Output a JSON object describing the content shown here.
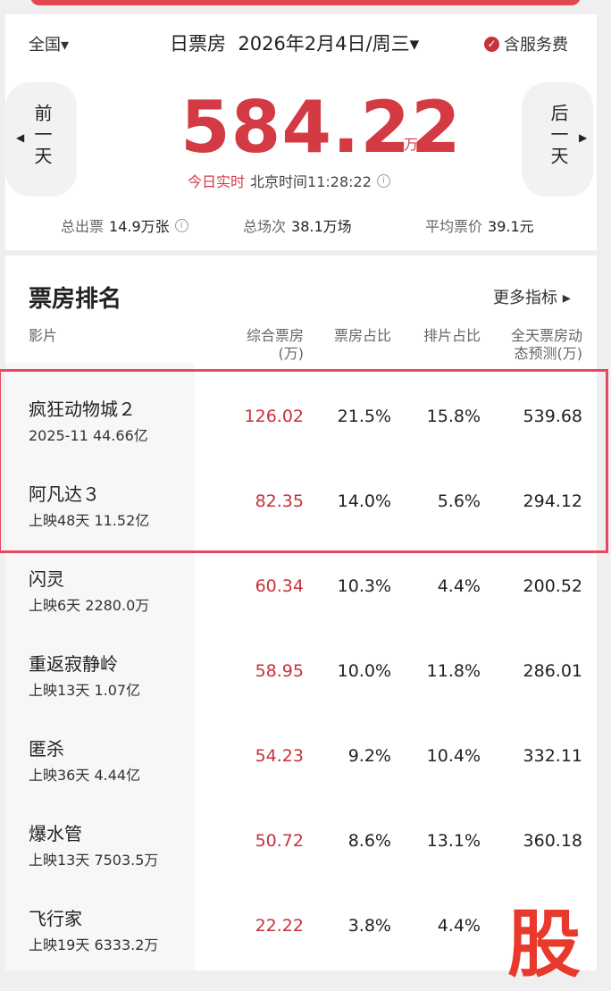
{
  "header": {
    "region": "全国",
    "region_arrow": "▾",
    "title": "日票房",
    "date": "2026年2月4日/周三",
    "date_arrow": "▾",
    "service_label": "含服务费",
    "check_icon": "✓"
  },
  "nav": {
    "prev_label": "前一天",
    "prev_arrow": "◀",
    "next_label": "后一天",
    "next_arrow": "▶"
  },
  "total": {
    "value": "584.22",
    "unit": "万",
    "live_label": "今日实时",
    "clock": "北京时间11:28:22",
    "info_icon": "i"
  },
  "stats": {
    "tickets_label": "总出票",
    "tickets_value": "14.9万张",
    "screenings_label": "总场次",
    "screenings_value": "38.1万场",
    "avg_price_label": "平均票价",
    "avg_price_value": "39.1元"
  },
  "ranking": {
    "title": "票房排名",
    "more_label": "更多指标",
    "more_arrow": "▸",
    "columns": {
      "movie": "影片",
      "box_office_l1": "综合票房",
      "box_office_l2": "(万)",
      "share": "票房占比",
      "schedule": "排片占比",
      "forecast_l1": "全天票房动",
      "forecast_l2": "态预测(万)"
    },
    "rows": [
      {
        "name": "疯狂动物城２",
        "sub": "2025-11 44.66亿",
        "box_office": "126.02",
        "share": "21.5%",
        "schedule": "15.8%",
        "forecast": "539.68"
      },
      {
        "name": "阿凡达３",
        "sub": "上映48天 11.52亿",
        "box_office": "82.35",
        "share": "14.0%",
        "schedule": "5.6%",
        "forecast": "294.12"
      },
      {
        "name": "闪灵",
        "sub": "上映6天 2280.0万",
        "box_office": "60.34",
        "share": "10.3%",
        "schedule": "4.4%",
        "forecast": "200.52"
      },
      {
        "name": "重返寂静岭",
        "sub": "上映13天 1.07亿",
        "box_office": "58.95",
        "share": "10.0%",
        "schedule": "11.8%",
        "forecast": "286.01"
      },
      {
        "name": "匿杀",
        "sub": "上映36天 4.44亿",
        "box_office": "54.23",
        "share": "9.2%",
        "schedule": "10.4%",
        "forecast": "332.11"
      },
      {
        "name": "爆水管",
        "sub": "上映13天 7503.5万",
        "box_office": "50.72",
        "share": "8.6%",
        "schedule": "13.1%",
        "forecast": "360.18"
      },
      {
        "name": "飞行家",
        "sub": "上映19天 6333.2万",
        "box_office": "22.22",
        "share": "3.8%",
        "schedule": "4.4%",
        "forecast": ""
      }
    ]
  },
  "watermark": "股",
  "colors": {
    "accent": "#d43a44",
    "highlight_border": "#e44a5d",
    "background": "#efeff1"
  }
}
